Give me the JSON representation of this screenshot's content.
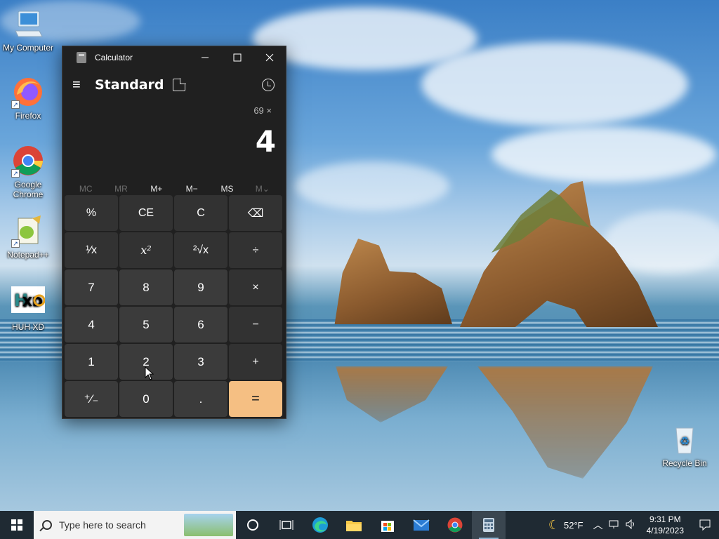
{
  "desktop": {
    "icons": [
      {
        "label": "My Computer",
        "icon": "computer-icon"
      },
      {
        "label": "Firefox",
        "icon": "firefox-icon"
      },
      {
        "label": "Google Chrome",
        "icon": "chrome-icon"
      },
      {
        "label": "Notepad++",
        "icon": "notepad-plus-plus-icon"
      },
      {
        "label": "HUH XD",
        "icon": "huh-xd-icon"
      },
      {
        "label": "Recycle Bin",
        "icon": "recycle-bin-icon"
      }
    ],
    "huh_logo_text": "XD"
  },
  "calculator": {
    "window_title": "Calculator",
    "mode": "Standard",
    "expression": "69 ×",
    "result": "4",
    "memory_buttons": [
      "MC",
      "MR",
      "M+",
      "M−",
      "MS",
      "M⌄"
    ],
    "keys": [
      "%",
      "CE",
      "C",
      "⌫",
      "¹⁄x",
      "x²",
      "²√x",
      "÷",
      "7",
      "8",
      "9",
      "×",
      "4",
      "5",
      "6",
      "−",
      "1",
      "2",
      "3",
      "+",
      "⁺⁄₋",
      "0",
      ".",
      "="
    ],
    "accent_color": "#f5bf83"
  },
  "taskbar": {
    "search_placeholder": "Type here to search",
    "weather": "52°F",
    "time": "9:31 PM",
    "date": "4/19/2023",
    "pinned": [
      "cortana-icon",
      "task-view-icon",
      "edge-icon",
      "file-explorer-icon",
      "store-icon",
      "mail-icon",
      "chrome-icon",
      "calculator-icon"
    ]
  }
}
